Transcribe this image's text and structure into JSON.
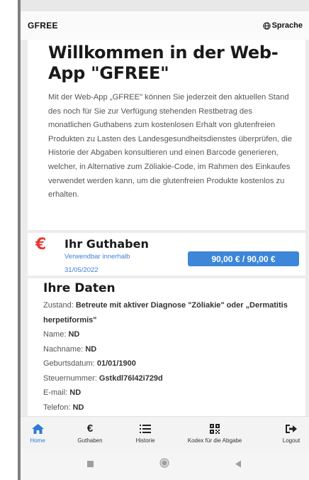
{
  "topbar": {
    "brand": "GFREE",
    "language_label": "Sprache"
  },
  "welcome": {
    "title": "Willkommen in der Web-App \"GFREE\"",
    "text": "Mit der Web-App „GFREE\" können Sie jederzeit den aktuellen Stand des noch für Sie zur Verfügung stehenden Restbetrag des monatlichen Guthabens zum kostenlosen Erhalt von glutenfreien Produkten zu Lasten des Landesgesundheitsdienstes überprüfen, die Historie der Abgaben konsultieren und einen Barcode generieren, welcher, in Alternative zum Zöliakie-Code, im Rahmen des Einkaufes verwendet werden kann, um die glutenfreien Produkte kostenlos zu erhalten."
  },
  "guthaben": {
    "icon": "euro-icon",
    "title": "Ihr Guthaben",
    "subtitle_line1": "Verwendbar innerhalb",
    "subtitle_line2": "31/05/2022",
    "amount": "90,00 € / 90,00 €",
    "accent_color": "#e53935",
    "badge_color": "#3d86d8"
  },
  "daten": {
    "title": "Ihre Daten",
    "rows": [
      {
        "label": "Zustand: ",
        "value": "Betreute mit aktiver Diagnose \"Zöliakie\" oder „Dermatitis herpetiformis\""
      },
      {
        "label": "Name: ",
        "value": "ND"
      },
      {
        "label": "Nachname: ",
        "value": "ND"
      },
      {
        "label": "Geburtsdatum: ",
        "value": "01/01/1900"
      },
      {
        "label": "Steuernummer: ",
        "value": "Gstkdl76l42i729d"
      },
      {
        "label": "E-mail: ",
        "value": "ND"
      },
      {
        "label": "Telefon: ",
        "value": "ND"
      }
    ]
  },
  "nav": {
    "active_color": "#2e7bd6",
    "items": [
      {
        "label": "Home",
        "icon": "home-icon"
      },
      {
        "label": "Guthaben",
        "icon": "euro-icon"
      },
      {
        "label": "Historie",
        "icon": "list-icon"
      },
      {
        "label": "Kodex für die Abgabe",
        "icon": "qr-code-icon"
      },
      {
        "label": "Logout",
        "icon": "logout-icon"
      }
    ]
  }
}
